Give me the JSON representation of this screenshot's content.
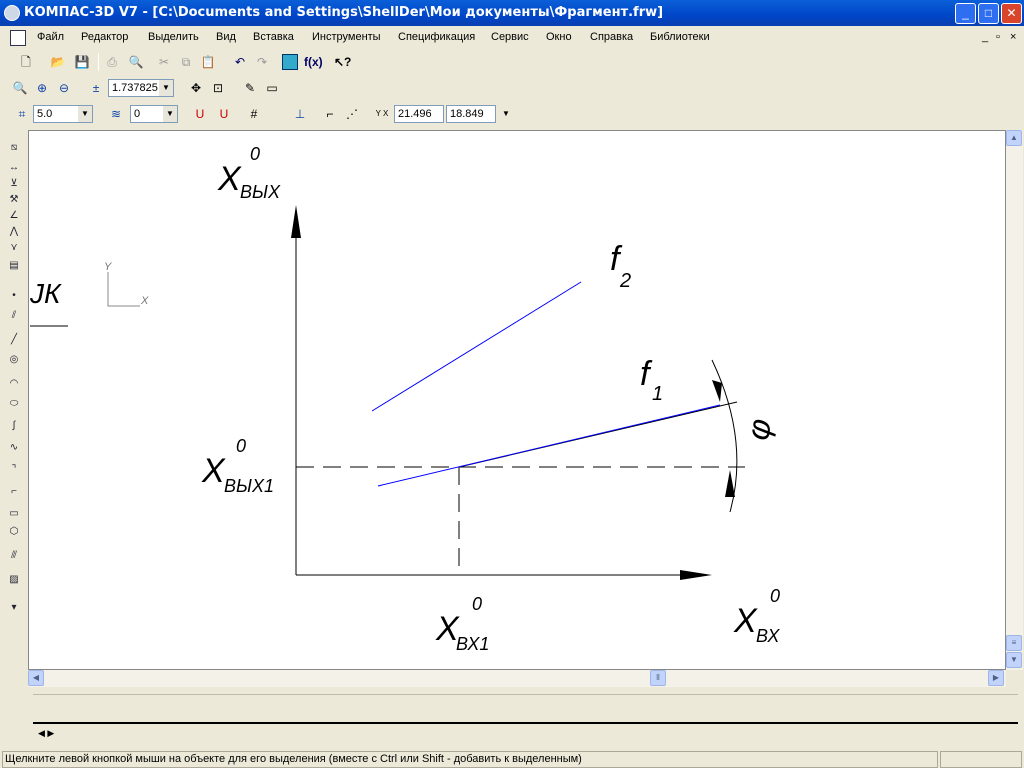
{
  "window": {
    "title": "КОМПАС-3D V7 - [C:\\Documents and Settings\\ShellDer\\Мои документы\\Фрагмент.frw]",
    "minimize": "_",
    "maximize": "□",
    "close": "✕"
  },
  "menu": [
    "Файл",
    "Редактор",
    "Выделить",
    "Вид",
    "Вставка",
    "Инструменты",
    "Спецификация",
    "Сервис",
    "Окно",
    "Справка",
    "Библиотеки"
  ],
  "menu_controls": [
    "_",
    "▫",
    "×"
  ],
  "toolbar": {
    "zoom_value": "1.737825",
    "step_value": "5.0",
    "layer_value": "0",
    "coord_x": "21.496",
    "coord_y": "18.849",
    "coord_label": "Y X"
  },
  "drawing": {
    "labels": {
      "y_axis": "X",
      "y_axis_sup": "0",
      "y_axis_sub": "ВЫХ",
      "x_axis": "X",
      "x_axis_sup": "0",
      "x_axis_sub": "ВХ",
      "y1": "X",
      "y1_sup": "0",
      "y1_sub": "ВЫХ1",
      "x1": "X",
      "x1_sup": "0",
      "x1_sub": "ВХ1",
      "f2": "f",
      "f2_sub": "2",
      "f1": "f",
      "f1_sub": "1",
      "angle": "φ",
      "partial": "ЈК",
      "cs_y": "Y",
      "cs_x": "X"
    },
    "line_color": "#0000ff"
  },
  "status": {
    "text": "Щелкните левой кнопкой мыши на объекте для его выделения (вместе с Ctrl или Shift - добавить к выделенным)"
  }
}
